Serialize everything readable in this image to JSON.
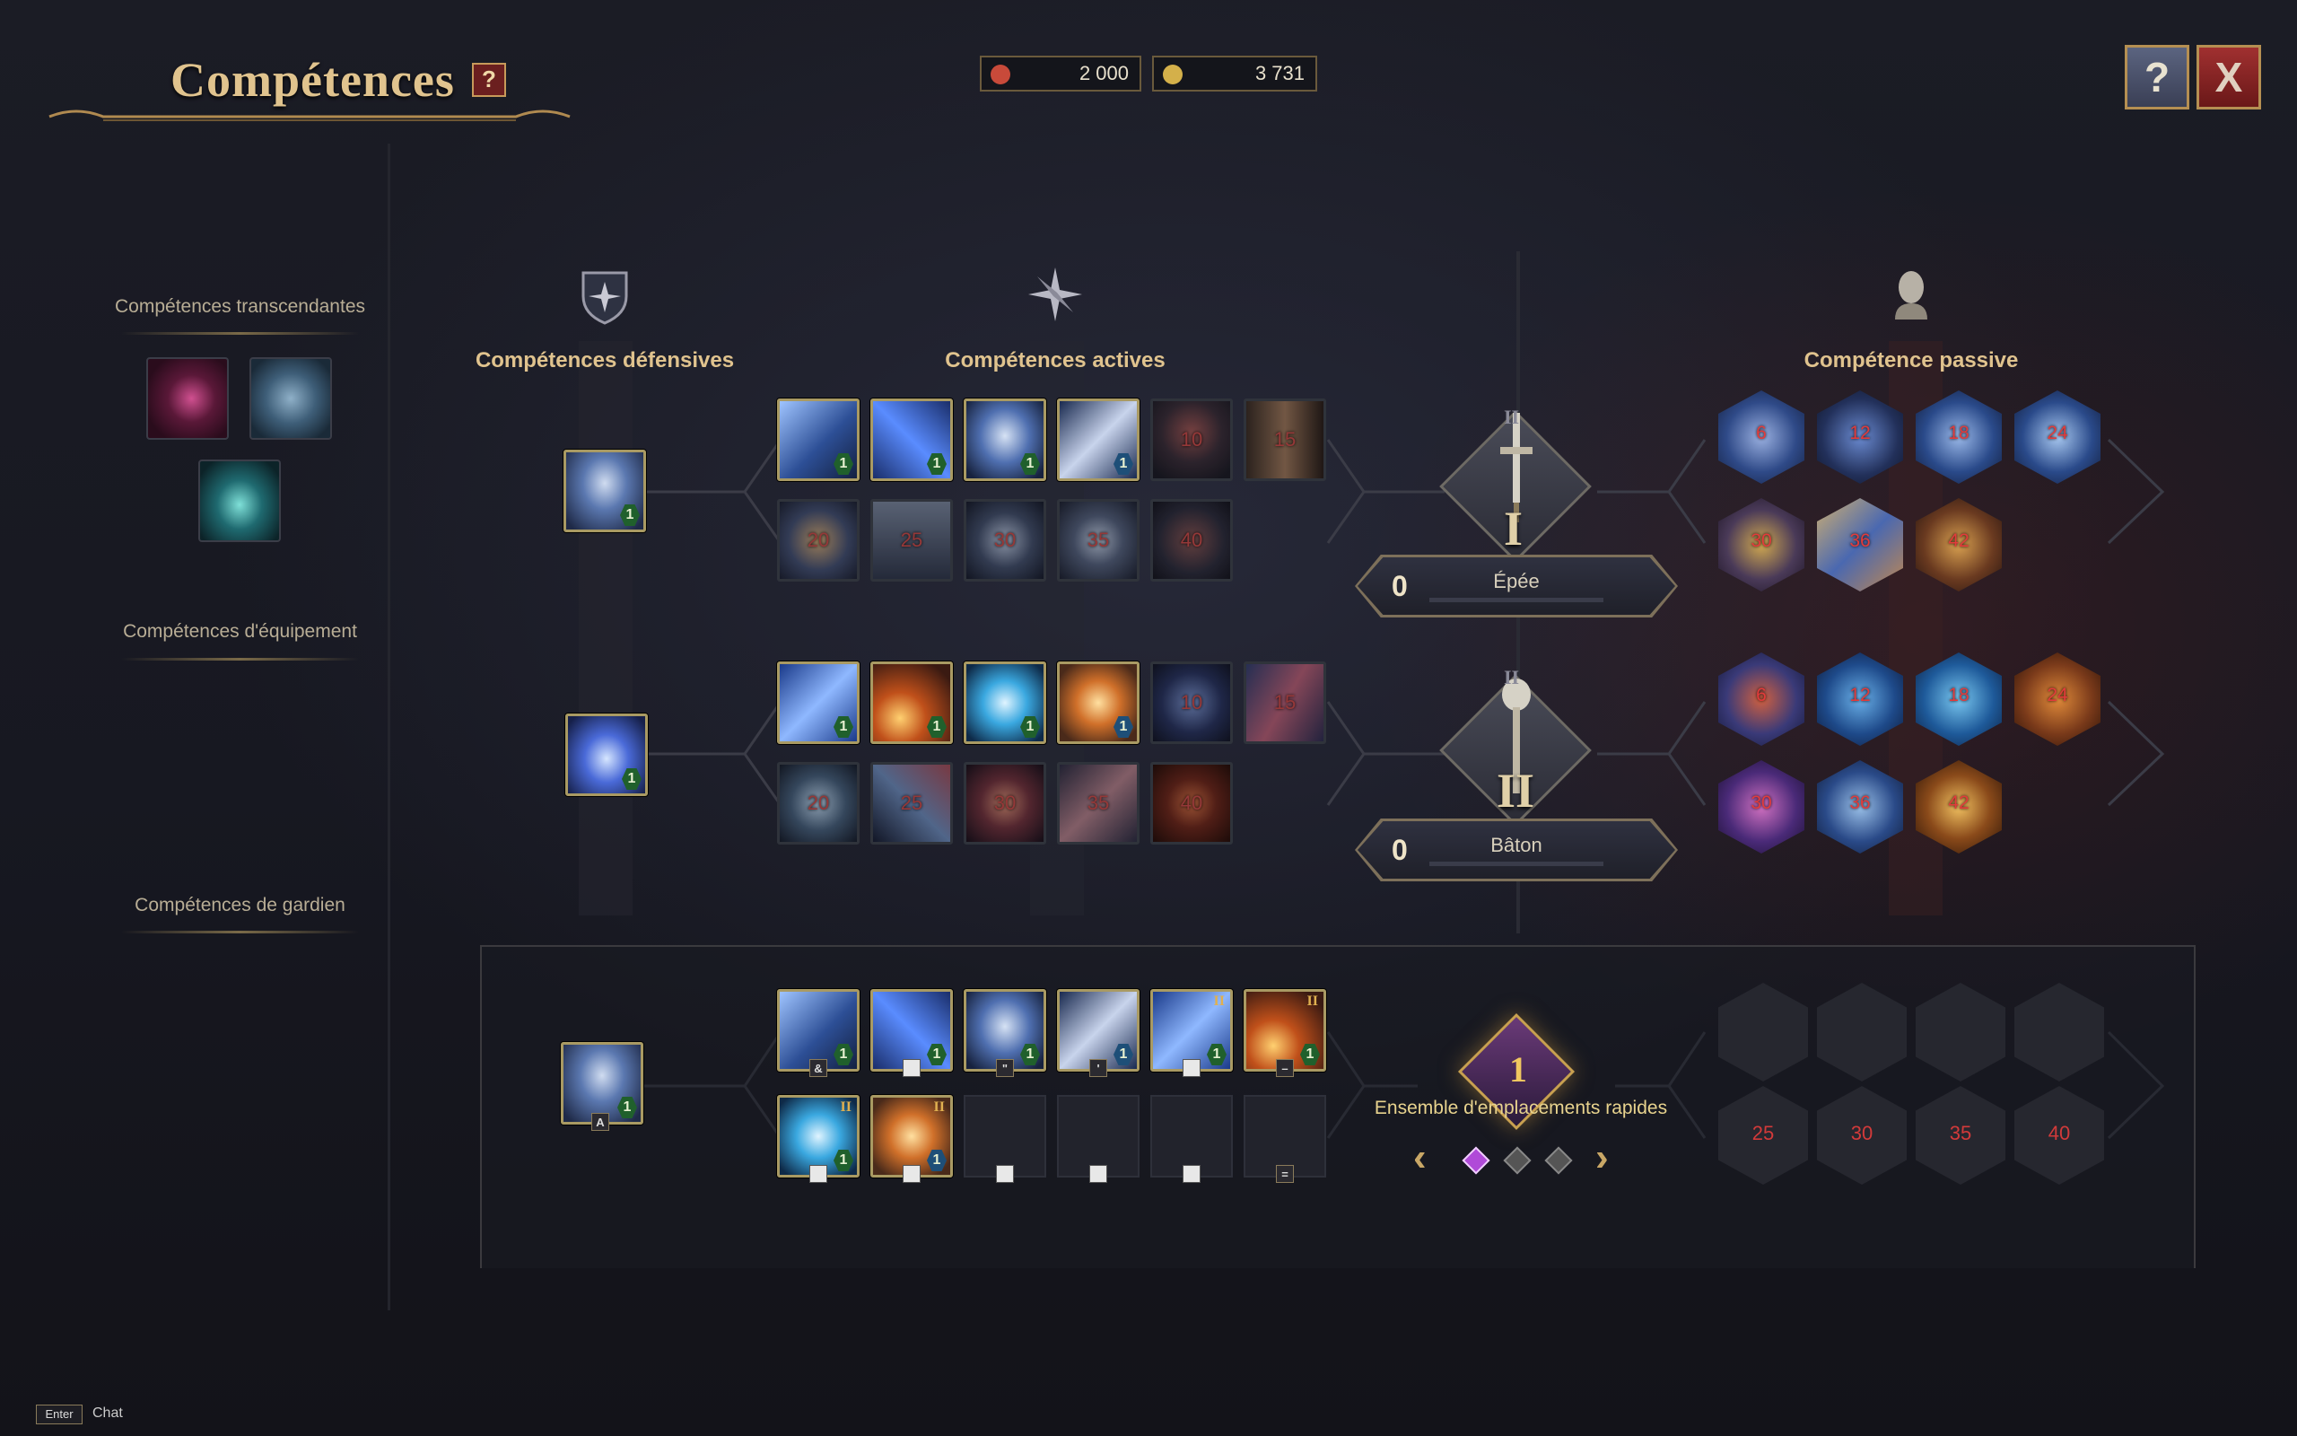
{
  "title": "Compétences",
  "help_label": "?",
  "currencies": [
    {
      "icon": "scroll-icon",
      "value": "2 000",
      "color": "#c84a3a"
    },
    {
      "icon": "gold-coin-icon",
      "value": "3 731",
      "color": "#d4b04a"
    }
  ],
  "top_buttons": {
    "guide_label": "?",
    "close_label": "X"
  },
  "left_panel": {
    "transcendent_title": "Compétences transcendantes",
    "equipment_title": "Compétences d'équipement",
    "guardian_title": "Compétences de gardien",
    "transcendent_icons": [
      "moon-icon",
      "wind-icon",
      "water-drop-icon"
    ]
  },
  "sections": {
    "defensive": "Compétences défensives",
    "active": "Compétences actives",
    "passive": "Compétence passive"
  },
  "weapons": [
    {
      "name": "Épée",
      "points": "0",
      "roman": "I",
      "tier_mark": "II",
      "defensive_skill": {
        "icon": "knight-shield-icon",
        "level": "1"
      },
      "active_row1": [
        {
          "icon": "blade-shield-icon",
          "level": "1",
          "req": ""
        },
        {
          "icon": "sword-slash-icon",
          "level": "1",
          "req": ""
        },
        {
          "icon": "shield-guard-icon",
          "level": "1",
          "req": ""
        },
        {
          "icon": "chain-blade-icon",
          "level": "1",
          "req": ""
        },
        {
          "icon": "roar-icon",
          "level": "",
          "req": "10"
        },
        {
          "icon": "warrior-leap-icon",
          "level": "",
          "req": "15"
        }
      ],
      "active_row2": [
        {
          "icon": "spin-slash-icon",
          "req": "20"
        },
        {
          "icon": "fortress-icon",
          "req": "25"
        },
        {
          "icon": "whirlwind-icon",
          "req": "30"
        },
        {
          "icon": "impact-icon",
          "req": "35"
        },
        {
          "icon": "sword-plunge-icon",
          "req": "40"
        }
      ],
      "passive_row1": [
        "6",
        "12",
        "18",
        "24"
      ],
      "passive_row2": [
        "30",
        "36",
        "42"
      ]
    },
    {
      "name": "Bâton",
      "points": "0",
      "roman": "II",
      "tier_mark": "II",
      "defensive_skill": {
        "icon": "arcane-barrier-icon",
        "level": "1"
      },
      "active_row1": [
        {
          "icon": "lightning-bolt-icon",
          "level": "1",
          "req": ""
        },
        {
          "icon": "fireball-icon",
          "level": "1",
          "req": ""
        },
        {
          "icon": "frost-nova-icon",
          "level": "1",
          "req": ""
        },
        {
          "icon": "explosion-icon",
          "level": "1",
          "req": ""
        },
        {
          "icon": "ice-spire-icon",
          "level": "",
          "req": "10"
        },
        {
          "icon": "arcane-wave-icon",
          "level": "",
          "req": "15"
        }
      ],
      "active_row2": [
        {
          "icon": "frost-armor-icon",
          "req": "20"
        },
        {
          "icon": "ice-shards-icon",
          "req": "25"
        },
        {
          "icon": "fire-burst-icon",
          "req": "30"
        },
        {
          "icon": "thunder-spear-icon",
          "req": "35"
        },
        {
          "icon": "inferno-icon",
          "req": "40"
        }
      ],
      "passive_row1": [
        "6",
        "12",
        "18",
        "24"
      ],
      "passive_row2": [
        "30",
        "36",
        "42"
      ]
    }
  ],
  "quick_slots": {
    "label": "Ensemble d'emplacements rapides",
    "set_number": "1",
    "defensive": {
      "icon": "knight-shield-icon",
      "level": "1",
      "key": "A"
    },
    "row1": [
      {
        "icon": "blade-shield-icon",
        "level": "1",
        "key": "&"
      },
      {
        "icon": "sword-slash-icon",
        "level": "1",
        "key": ""
      },
      {
        "icon": "shield-guard-icon",
        "level": "1",
        "key": "\""
      },
      {
        "icon": "chain-blade-icon",
        "level": "1",
        "key": "'"
      },
      {
        "icon": "lightning-bolt-icon",
        "level": "1",
        "key": "",
        "tier": "II"
      },
      {
        "icon": "fireball-icon",
        "level": "1",
        "key": "–",
        "tier": "II"
      }
    ],
    "row2": [
      {
        "icon": "frost-nova-icon",
        "level": "1",
        "key": "",
        "tier": "II"
      },
      {
        "icon": "explosion-icon",
        "level": "1",
        "key": "",
        "tier": "II"
      },
      {
        "icon": "",
        "key": ""
      },
      {
        "icon": "",
        "key": ""
      },
      {
        "icon": "",
        "key": ""
      },
      {
        "icon": "",
        "key": "="
      }
    ],
    "passive_locked": [
      "25",
      "30",
      "35",
      "40"
    ],
    "pages": [
      true,
      false,
      false
    ]
  },
  "chat": {
    "key": "Enter",
    "label": "Chat"
  }
}
